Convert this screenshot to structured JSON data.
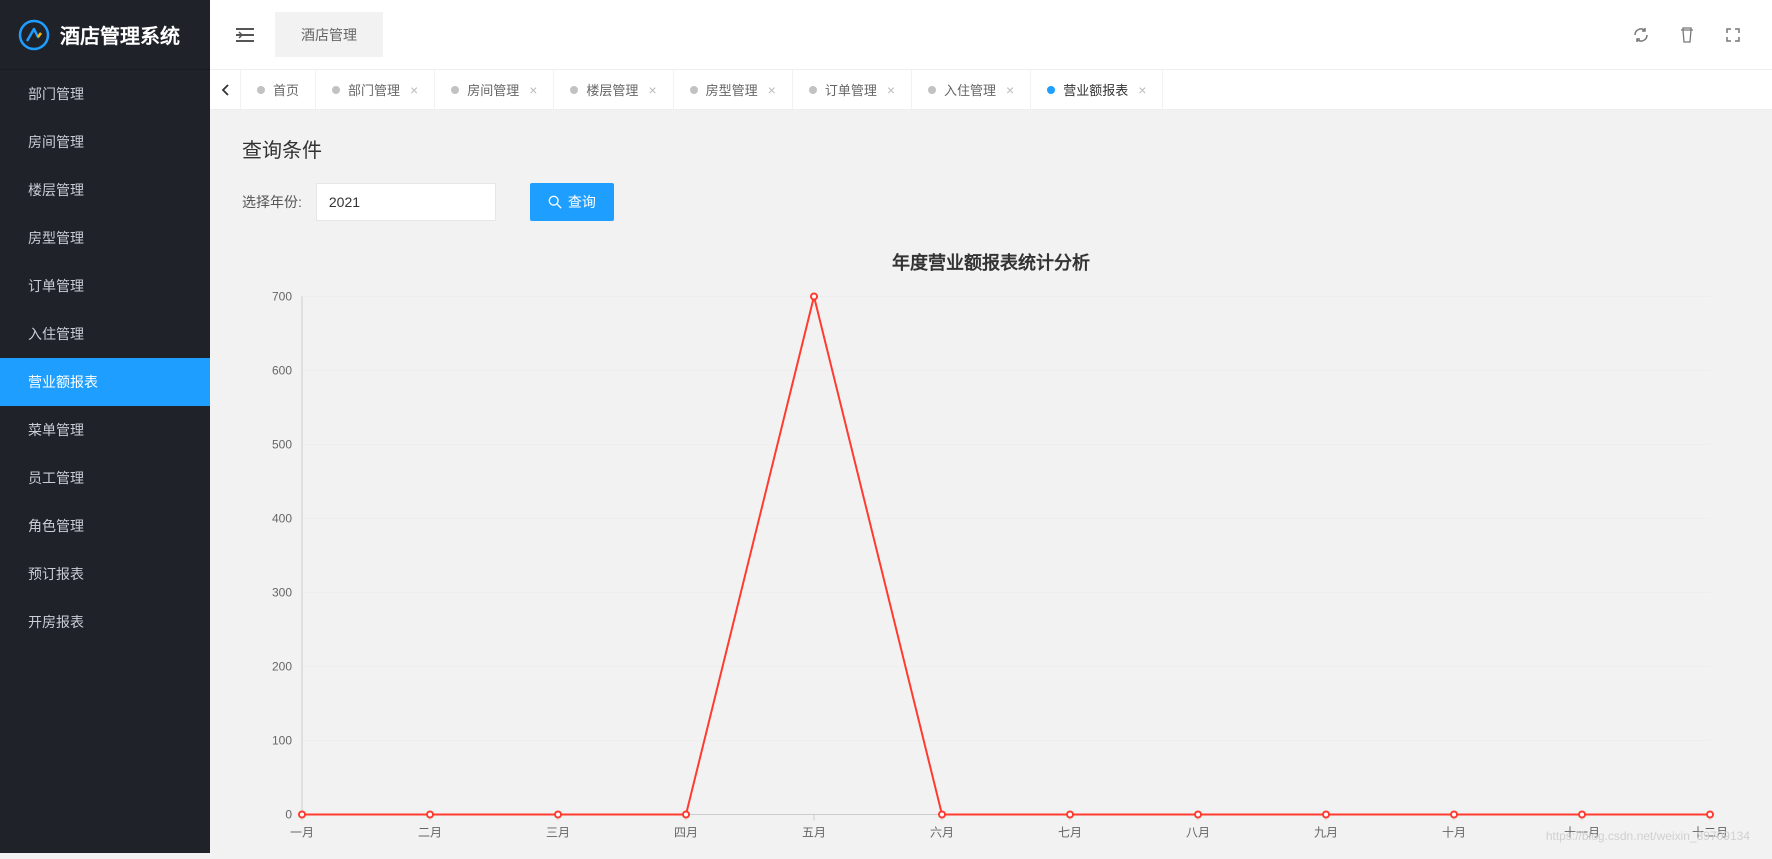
{
  "app_title": "酒店管理系统",
  "topbar": {
    "primary_tab": "酒店管理"
  },
  "sidebar": {
    "items": [
      {
        "label": "部门管理"
      },
      {
        "label": "房间管理"
      },
      {
        "label": "楼层管理"
      },
      {
        "label": "房型管理"
      },
      {
        "label": "订单管理"
      },
      {
        "label": "入住管理"
      },
      {
        "label": "营业额报表",
        "active": true
      },
      {
        "label": "菜单管理"
      },
      {
        "label": "员工管理"
      },
      {
        "label": "角色管理"
      },
      {
        "label": "预订报表"
      },
      {
        "label": "开房报表"
      }
    ]
  },
  "tabs": [
    {
      "label": "首页",
      "closable": false
    },
    {
      "label": "部门管理",
      "closable": true
    },
    {
      "label": "房间管理",
      "closable": true
    },
    {
      "label": "楼层管理",
      "closable": true
    },
    {
      "label": "房型管理",
      "closable": true
    },
    {
      "label": "订单管理",
      "closable": true
    },
    {
      "label": "入住管理",
      "closable": true
    },
    {
      "label": "营业额报表",
      "closable": true,
      "active": true
    }
  ],
  "query": {
    "section_title": "查询条件",
    "year_label": "选择年份:",
    "year_value": "2021",
    "button_label": "查询"
  },
  "chart_data": {
    "type": "line",
    "title": "年度营业额报表统计分析",
    "categories": [
      "一月",
      "二月",
      "三月",
      "四月",
      "五月",
      "六月",
      "七月",
      "八月",
      "九月",
      "十月",
      "十一月",
      "十二月"
    ],
    "values": [
      0,
      0,
      0,
      0,
      700,
      0,
      0,
      0,
      0,
      0,
      0,
      0
    ],
    "ylim": [
      0,
      700
    ],
    "yticks": [
      0,
      100,
      200,
      300,
      400,
      500,
      600,
      700
    ],
    "series_color": "#ff3b30"
  },
  "watermark": "https://blog.csdn.net/weixin_39709134"
}
